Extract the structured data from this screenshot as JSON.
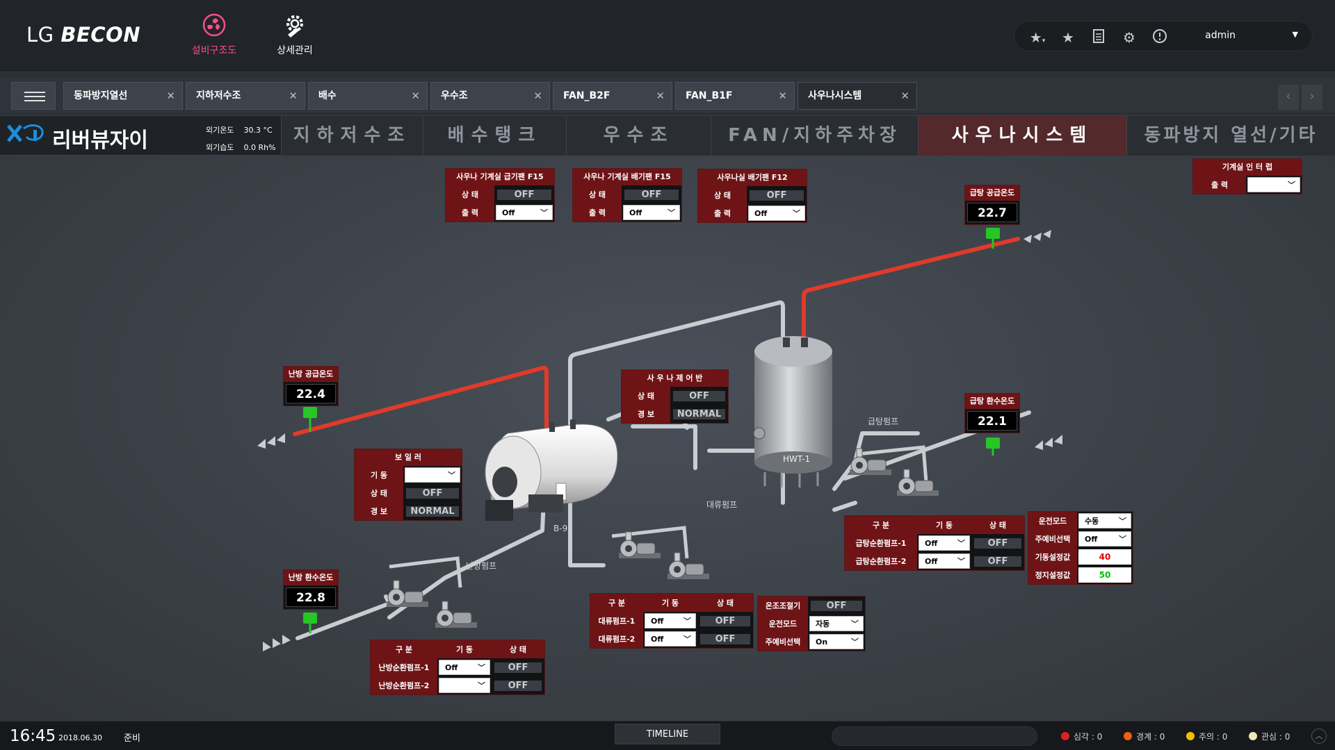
{
  "brand": {
    "logo_prefix": "LG ",
    "logo_name": "BECON"
  },
  "nav": [
    {
      "label": "설비구조도",
      "icon": "flower-swirl-icon"
    },
    {
      "label": "상세관리",
      "icon": "gear-wrench-icon"
    }
  ],
  "user": {
    "name": "admin"
  },
  "tabs": [
    {
      "label": "동파방지열선"
    },
    {
      "label": "지하저수조"
    },
    {
      "label": "배수"
    },
    {
      "label": "우수조"
    },
    {
      "label": "FAN_B2F"
    },
    {
      "label": "FAN_B1F"
    },
    {
      "label": "사우나시스템"
    }
  ],
  "site": {
    "name": "리버뷰자이",
    "outdoor_temp_label": "외기온도",
    "outdoor_temp_value": "30.3 °C",
    "outdoor_humid_label": "외기습도",
    "outdoor_humid_value": "0.0 Rh%"
  },
  "menu_tabs": [
    {
      "label": "지하저수조"
    },
    {
      "label": "배수탱크"
    },
    {
      "label": "우수조"
    },
    {
      "label": "FAN/지하주차장"
    },
    {
      "label": "사우나시스템",
      "active": true
    },
    {
      "label": "동파방지 열선/기타"
    }
  ],
  "fans": [
    {
      "title": "사우나 기계실 급기팬 F15",
      "status_label": "상 태",
      "status": "OFF",
      "output_label": "출 력",
      "output": "Off"
    },
    {
      "title": "사우나 기계실 배기팬 F15",
      "status_label": "상 태",
      "status": "OFF",
      "output_label": "출 력",
      "output": "Off"
    },
    {
      "title": "사우나실 배기팬 F12",
      "status_label": "상 태",
      "status": "OFF",
      "output_label": "출 력",
      "output": "Off"
    }
  ],
  "interlock": {
    "title": "기계실 인 터 럽",
    "output_label": "출 력",
    "output": ""
  },
  "temps": {
    "hot_supply": {
      "label": "급탕 공급온도",
      "value": "22.7"
    },
    "hot_return": {
      "label": "급탕 환수온도",
      "value": "22.1"
    },
    "heat_supply": {
      "label": "난방 공급온도",
      "value": "22.4"
    },
    "heat_return": {
      "label": "난방 환수온도",
      "value": "22.8"
    }
  },
  "sauna_panel": {
    "title": "사 우 나 제 어 반",
    "status_label": "상 태",
    "status": "OFF",
    "alarm_label": "경 보",
    "alarm": "NORMAL"
  },
  "boiler": {
    "title": "보 일 러",
    "run_label": "기 동",
    "run": "",
    "status_label": "상 태",
    "status": "OFF",
    "alarm_label": "경 보",
    "alarm": "NORMAL"
  },
  "labels": {
    "boiler_tag": "B-9",
    "tank_tag": "HWT-1",
    "hot_pump": "급탕펌프",
    "conv_pump": "대류펌프",
    "heat_pump": "난방펌프"
  },
  "hot_pumps": {
    "headers": [
      "구 분",
      "기 동",
      "상 태"
    ],
    "rows": [
      {
        "name": "급탕순환펌프-1",
        "run": "Off",
        "status": "OFF"
      },
      {
        "name": "급탕순환펌프-2",
        "run": "Off",
        "status": "OFF"
      }
    ]
  },
  "hot_settings": {
    "mode_label": "운전모드",
    "mode": "수동",
    "standby_label": "주예비선택",
    "standby": "Off",
    "start_label": "기동설정값",
    "start": "40",
    "stop_label": "정지설정값",
    "stop": "50"
  },
  "conv_pumps": {
    "headers": [
      "구 분",
      "기 동",
      "상 태"
    ],
    "rows": [
      {
        "name": "대류펌프-1",
        "run": "Off",
        "status": "OFF"
      },
      {
        "name": "대류펌프-2",
        "run": "Off",
        "status": "OFF"
      }
    ]
  },
  "thermo": {
    "ctrl_label": "온조조절기",
    "ctrl": "OFF",
    "mode_label": "운전모드",
    "mode": "자동",
    "standby_label": "주예비선택",
    "standby": "On"
  },
  "heat_pumps": {
    "headers": [
      "구 분",
      "기 동",
      "상 태"
    ],
    "rows": [
      {
        "name": "난방순환펌프-1",
        "run": "Off",
        "status": "OFF"
      },
      {
        "name": "난방순환펌프-2",
        "run": "",
        "status": "OFF"
      }
    ]
  },
  "statusbar": {
    "time": "16:45",
    "date": "2018.06.30",
    "state": "준비",
    "timeline": "TIMELINE",
    "alarms": [
      {
        "label": "심각 : 0",
        "color": "#e02020"
      },
      {
        "label": "경계 : 0",
        "color": "#f06010"
      },
      {
        "label": "주의 : 0",
        "color": "#f0c000"
      },
      {
        "label": "관심 : 0",
        "color": "#f2e7b0"
      }
    ]
  },
  "colors": {
    "accent_nav": "#ff4d8c",
    "panel_header": "#6e1416",
    "active_tab": "#53292b",
    "hot_pipe": "#e23a2a",
    "cold_pipe": "#c9ccd0",
    "start_value": "#e00000",
    "stop_value": "#00c000"
  }
}
